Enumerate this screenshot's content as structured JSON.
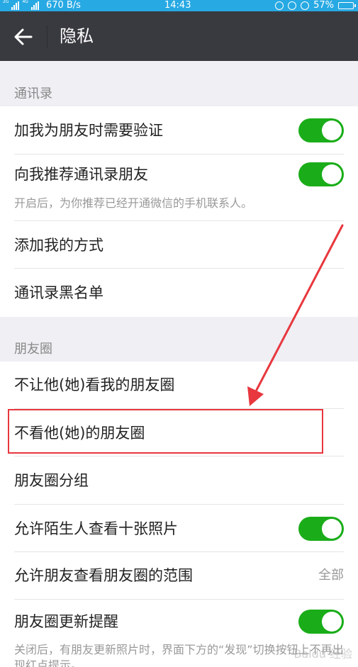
{
  "status_bar": {
    "network_1": "2G",
    "network_2": "4G",
    "speed": "670 B/s",
    "time": "14:43",
    "battery": "57%"
  },
  "header": {
    "title": "隐私"
  },
  "sections": {
    "contacts": {
      "label": "通讯录",
      "items": [
        {
          "label": "加我为朋友时需要验证",
          "toggle": true
        },
        {
          "label": "向我推荐通讯录朋友",
          "toggle": true,
          "description": "开启后，为你推荐已经开通微信的手机联系人。"
        },
        {
          "label": "添加我的方式"
        },
        {
          "label": "通讯录黑名单"
        }
      ]
    },
    "moments": {
      "label": "朋友圈",
      "items": [
        {
          "label": "不让他(她)看我的朋友圈"
        },
        {
          "label": "不看他(她)的朋友圈"
        },
        {
          "label": "朋友圈分组"
        },
        {
          "label": "允许陌生人查看十张照片",
          "toggle": true
        },
        {
          "label": "允许朋友查看朋友圈的范围",
          "value": "全部"
        },
        {
          "label": "朋友圈更新提醒",
          "toggle": true,
          "description": "关闭后，有朋友更新照片时，界面下方的“发现”切换按钮上不再出现红点提示。"
        }
      ]
    }
  },
  "annotation": {
    "highlight_color": "#e8373e"
  },
  "watermark": "Baidu 经验"
}
